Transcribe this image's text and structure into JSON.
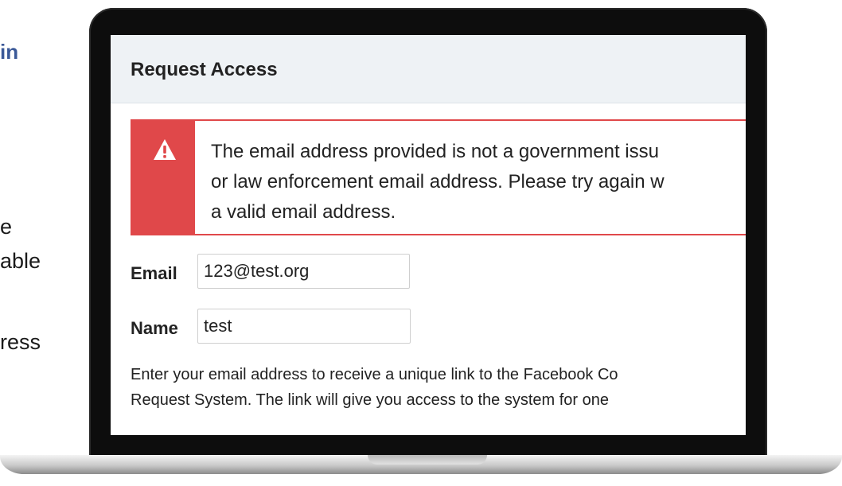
{
  "side_text": {
    "title_fragment": "in",
    "line1": "e",
    "line2": "able",
    "line3": "ress"
  },
  "request_access": {
    "title": "Request Access",
    "alert": {
      "icon": "warning-icon",
      "lines": [
        "The email address provided is not a government issu",
        "or law enforcement email address. Please try again w",
        "a valid email address."
      ],
      "color": "#e0484a"
    },
    "email": {
      "label": "Email",
      "value": "123@test.org"
    },
    "name": {
      "label": "Name",
      "value": "test"
    },
    "help_lines": [
      "Enter your email address to receive a unique link to the Facebook Co",
      "Request System. The link will give you access to the system for one"
    ]
  }
}
